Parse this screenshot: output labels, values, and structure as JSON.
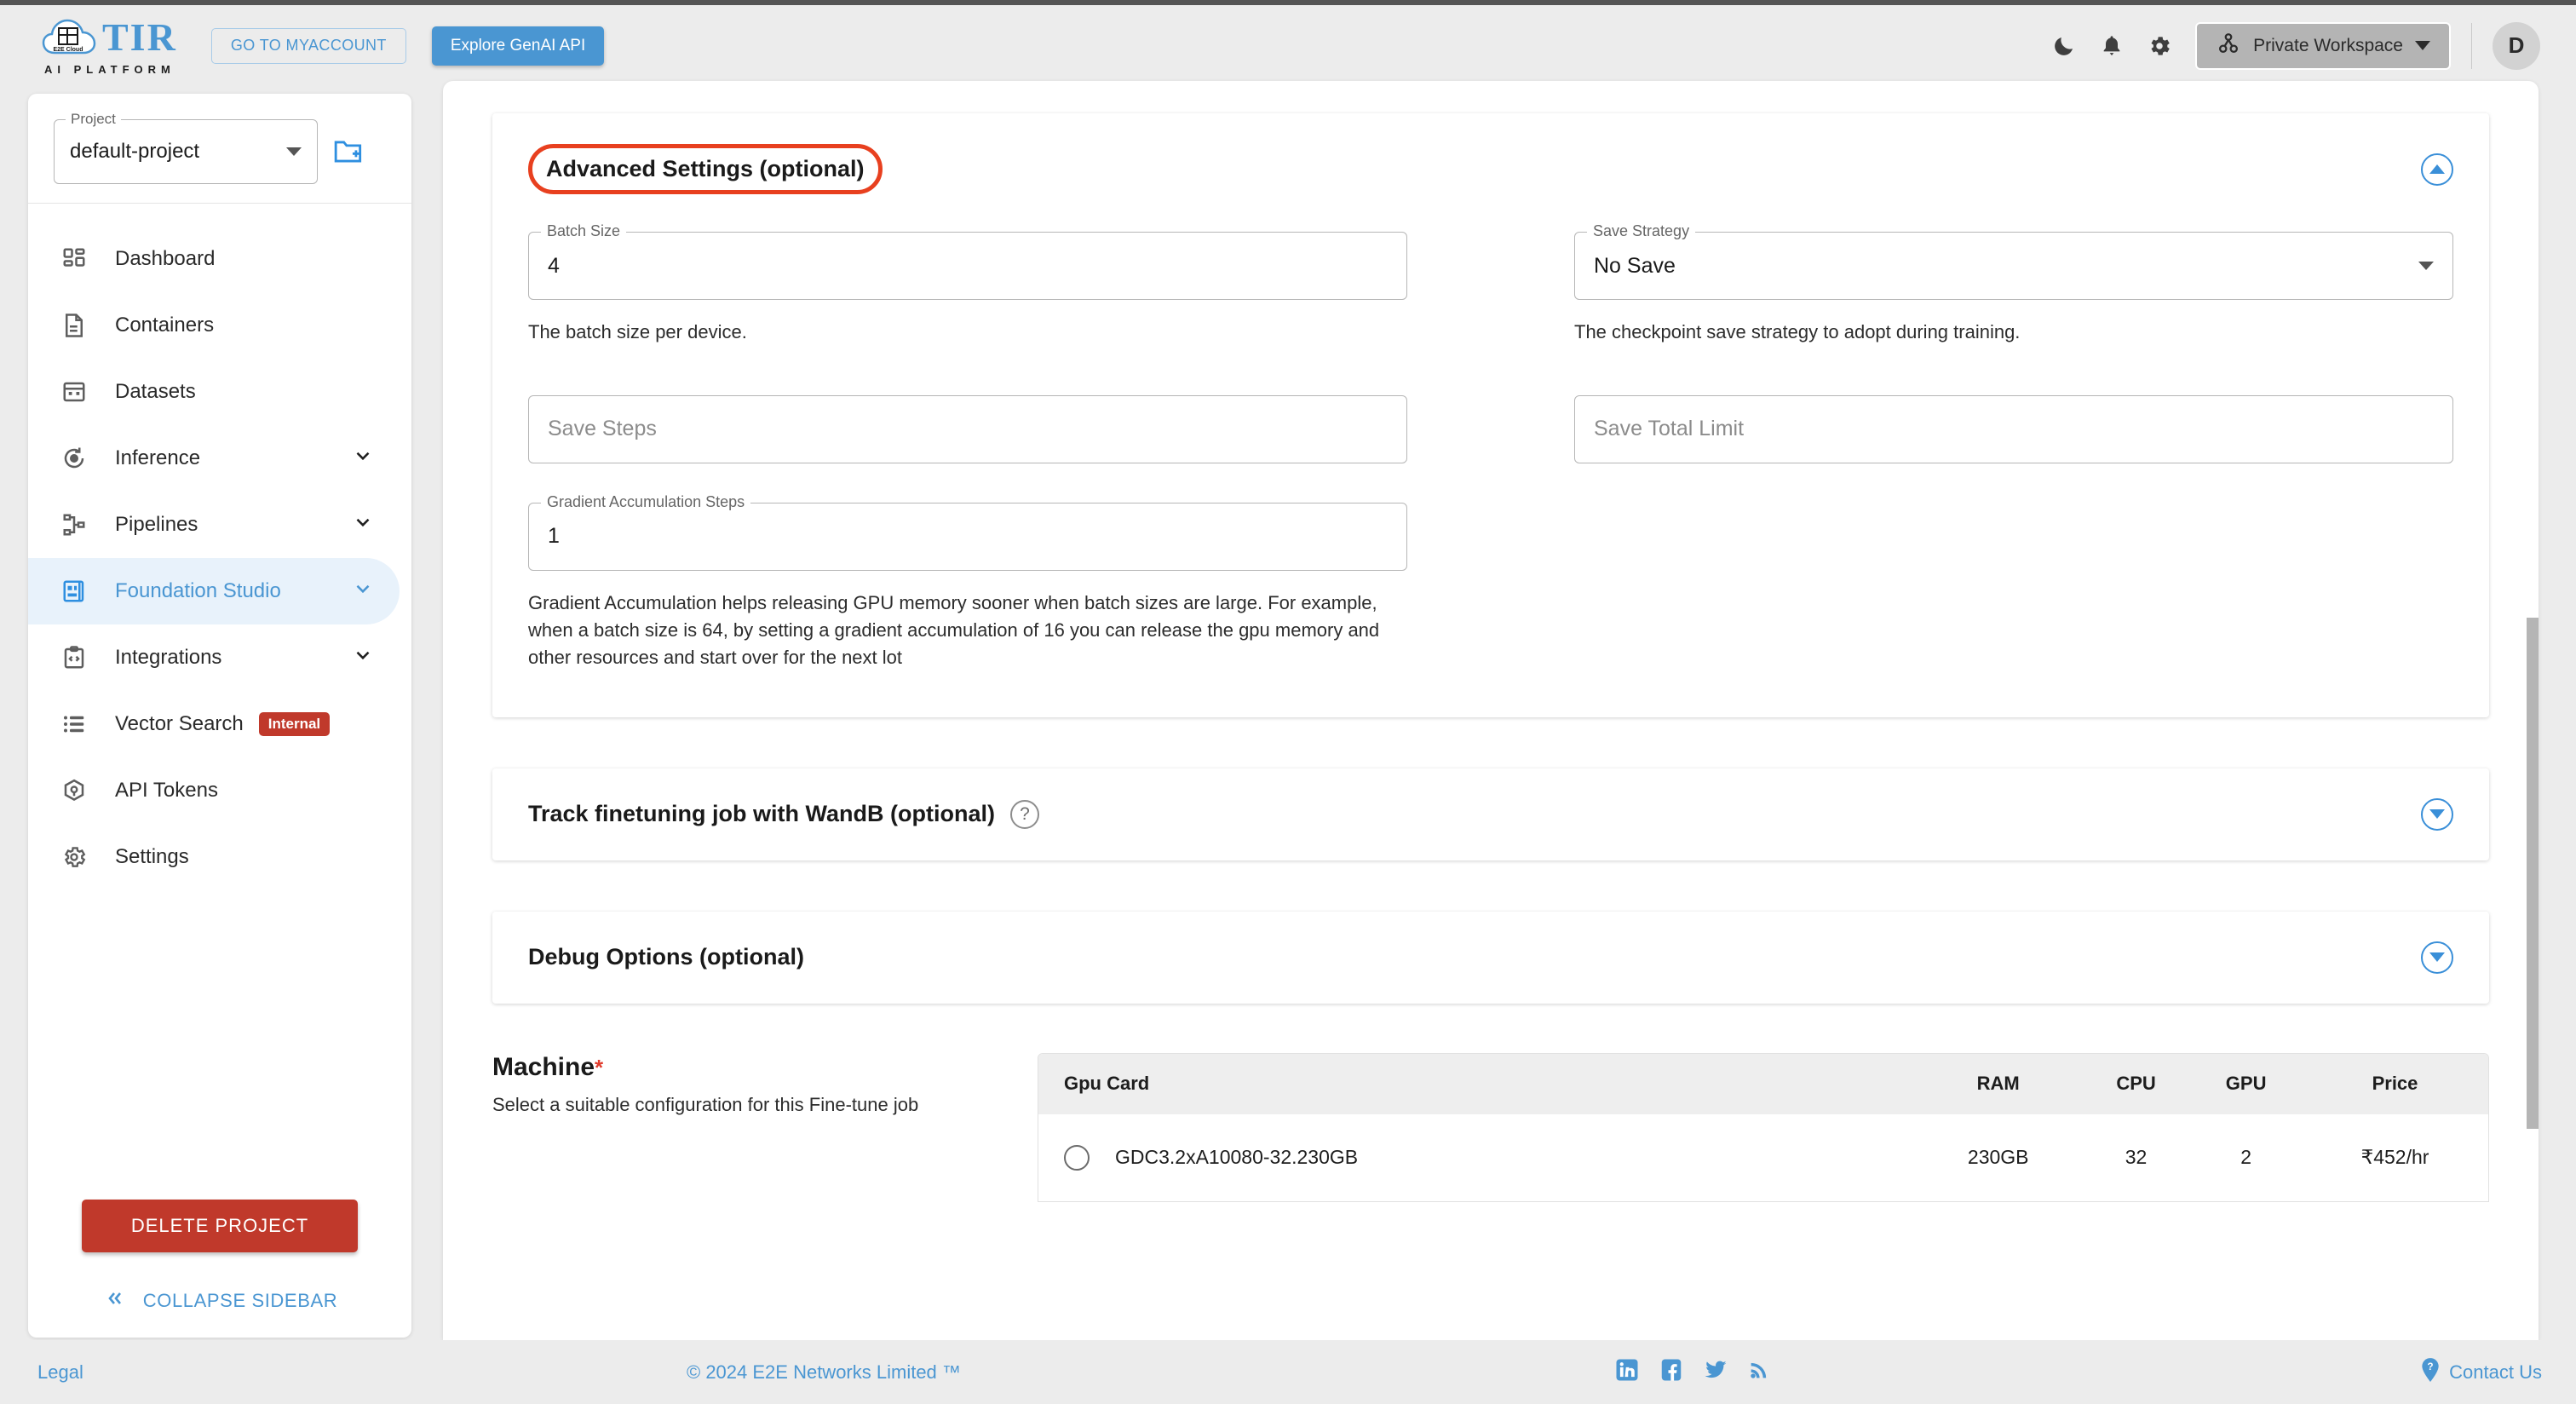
{
  "header": {
    "logo": {
      "brand": "TIR",
      "tagline": "AI PLATFORM",
      "cloud_label": "E2E Cloud"
    },
    "myaccount_label": "GO TO MYACCOUNT",
    "genai_label": "Explore GenAI API",
    "icons": [
      "dark-mode-icon",
      "notifications-icon",
      "settings-gear-icon"
    ],
    "workspace_label": "Private Workspace",
    "avatar_initial": "D"
  },
  "sidebar": {
    "project": {
      "legend": "Project",
      "value": "default-project"
    },
    "items": [
      {
        "label": "Dashboard",
        "icon": "dashboard-icon",
        "expandable": false,
        "active": false,
        "badge": ""
      },
      {
        "label": "Containers",
        "icon": "document-icon",
        "expandable": false,
        "active": false,
        "badge": ""
      },
      {
        "label": "Datasets",
        "icon": "grid-icon",
        "expandable": false,
        "active": false,
        "badge": ""
      },
      {
        "label": "Inference",
        "icon": "inference-icon",
        "expandable": true,
        "active": false,
        "badge": ""
      },
      {
        "label": "Pipelines",
        "icon": "pipelines-icon",
        "expandable": true,
        "active": false,
        "badge": ""
      },
      {
        "label": "Foundation Studio",
        "icon": "foundation-studio-icon",
        "expandable": true,
        "active": true,
        "badge": ""
      },
      {
        "label": "Integrations",
        "icon": "integrations-icon",
        "expandable": true,
        "active": false,
        "badge": ""
      },
      {
        "label": "Vector Search",
        "icon": "vector-search-icon",
        "expandable": false,
        "active": false,
        "badge": "Internal"
      },
      {
        "label": "API Tokens",
        "icon": "api-tokens-icon",
        "expandable": false,
        "active": false,
        "badge": ""
      },
      {
        "label": "Settings",
        "icon": "settings-icon",
        "expandable": false,
        "active": false,
        "badge": ""
      }
    ],
    "delete_label": "DELETE PROJECT",
    "collapse_label": "COLLAPSE SIDEBAR"
  },
  "main": {
    "advanced": {
      "title": "Advanced Settings (optional)",
      "highlight_color": "#e8401f",
      "batch_size": {
        "legend": "Batch Size",
        "value": "4",
        "helper": "The batch size per device."
      },
      "save_strategy": {
        "legend": "Save Strategy",
        "value": "No Save",
        "helper": "The checkpoint save strategy to adopt during training."
      },
      "save_steps": {
        "placeholder": "Save Steps",
        "value": ""
      },
      "save_total_limit": {
        "placeholder": "Save Total Limit",
        "value": ""
      },
      "gradient_accumulation": {
        "legend": "Gradient Accumulation Steps",
        "value": "1",
        "helper": "Gradient Accumulation helps releasing GPU memory sooner when batch sizes are large. For example, when a batch size is 64, by setting a gradient accumulation of 16 you can release the gpu memory and other resources and start over for the next lot"
      }
    },
    "wandb": {
      "title": "Track finetuning job with WandB (optional)",
      "help": "?"
    },
    "debug": {
      "title": "Debug Options (optional)"
    },
    "machine": {
      "title": "Machine",
      "required_mark": "*",
      "subtitle": "Select a suitable configuration for this Fine-tune job",
      "columns": [
        "Gpu Card",
        "RAM",
        "CPU",
        "GPU",
        "Price"
      ],
      "rows": [
        {
          "gpu_card": "GDC3.2xA10080-32.230GB",
          "ram": "230GB",
          "cpu": "32",
          "gpu": "2",
          "price": "₹452/hr",
          "selected": false
        }
      ]
    }
  },
  "footer": {
    "legal": "Legal",
    "copyright": "© 2024 E2E Networks Limited ™",
    "social": [
      "linkedin-icon",
      "facebook-icon",
      "twitter-icon",
      "rss-icon"
    ],
    "contact": "Contact Us"
  }
}
